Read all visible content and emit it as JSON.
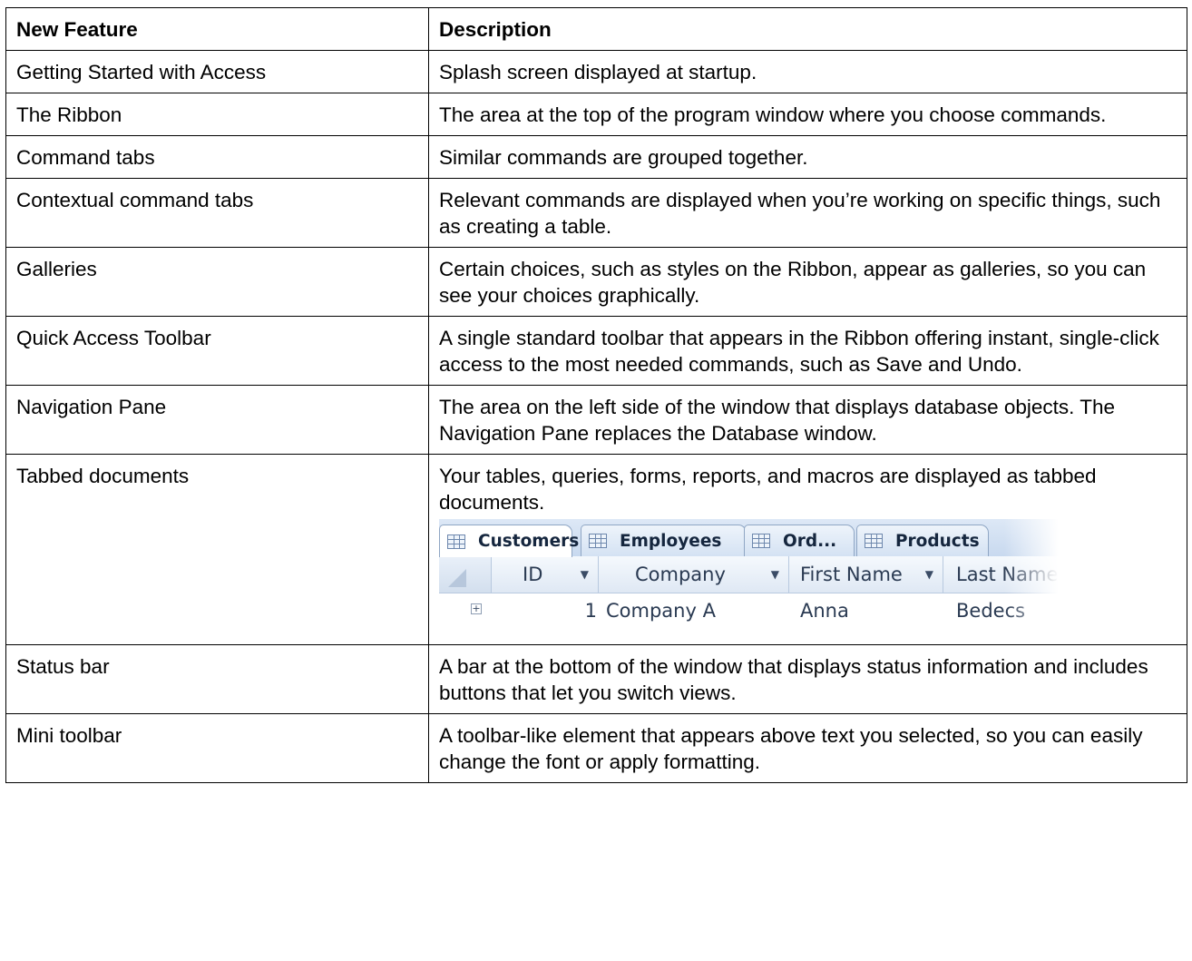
{
  "table": {
    "headers": {
      "feature": "New Feature",
      "description": "Description"
    },
    "rows": [
      {
        "feature": "Getting Started with Access",
        "description": "Splash screen displayed at startup."
      },
      {
        "feature": "The Ribbon",
        "description": "The area at the top of the program window where you choose commands."
      },
      {
        "feature": "Command tabs",
        "description": "Similar commands are grouped together."
      },
      {
        "feature": "Contextual command tabs",
        "description": "Relevant commands are displayed when you’re working on specific things, such as creating a table."
      },
      {
        "feature": "Galleries",
        "description": "Certain choices, such as styles on the Ribbon, appear as galleries, so you can see your choices graphically."
      },
      {
        "feature": "Quick Access Toolbar",
        "description": "A single standard toolbar that appears in the Ribbon offering instant, single-click access to the most needed commands, such as Save and Undo."
      },
      {
        "feature": "Navigation Pane",
        "description": "The area on the left side of the window that displays database objects. The Navigation Pane replaces the Database window."
      },
      {
        "feature": "Tabbed documents",
        "description": "Your tables, queries, forms, reports, and macros are displayed as tabbed documents."
      },
      {
        "feature": "Status bar",
        "description": "A bar at the bottom of the window that displays status information and includes buttons that let you switch views."
      },
      {
        "feature": "Mini toolbar",
        "description": "A toolbar-like element that appears above text you selected, so you can easily change the font or apply formatting."
      }
    ]
  },
  "tabbed_example": {
    "tabs": [
      "Customers",
      "Employees",
      "Ord...",
      "Products"
    ],
    "columns": [
      "ID",
      "Company",
      "First Name",
      "Last Name"
    ],
    "row": {
      "id": "1",
      "company": "Company A",
      "first_name": "Anna",
      "last_name": "Bedecs"
    },
    "icons": {
      "tab": "table-icon",
      "dropdown": "dropdown-arrow-icon",
      "expand": "expand-plus-icon"
    }
  }
}
